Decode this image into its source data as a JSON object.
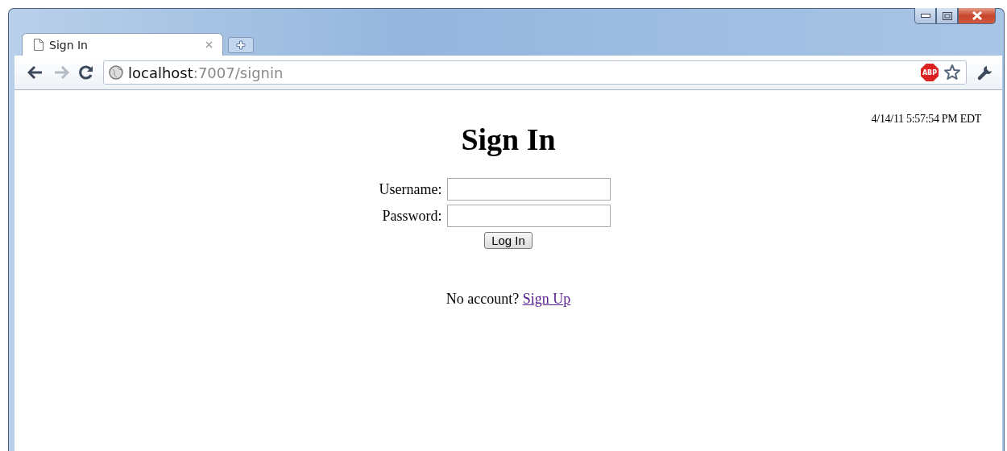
{
  "window": {
    "tabs": [
      {
        "title": "Sign In",
        "selected": true
      }
    ],
    "address": {
      "host": "localhost",
      "path": ":7007/signin"
    },
    "extension_badge": "ABP"
  },
  "page": {
    "timestamp": "4/14/11 5:57:54 PM EDT",
    "heading": "Sign In",
    "fields": [
      {
        "label": "Username:"
      },
      {
        "label": "Password:"
      }
    ],
    "submit": "Log In",
    "signup_prompt": "No account?",
    "signup_link": "Sign Up"
  }
}
